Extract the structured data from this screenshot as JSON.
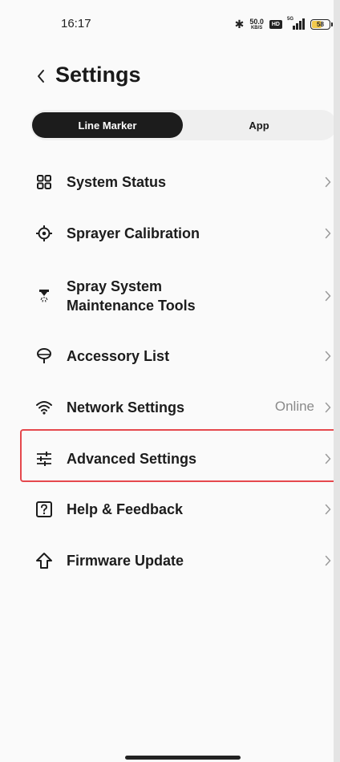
{
  "status_bar": {
    "time": "16:17",
    "net_speed_value": "50.0",
    "net_speed_unit": "KB/S",
    "hd_badge": "HD",
    "network_type": "5G",
    "battery_level": "58",
    "icons": [
      "bluetooth-icon",
      "hd-icon",
      "signal-icon",
      "battery-icon"
    ]
  },
  "header": {
    "title": "Settings",
    "back_icon": "chevron-left-icon"
  },
  "segment": {
    "tabs": [
      {
        "label": "Line Marker",
        "selected": true
      },
      {
        "label": "App",
        "selected": false
      }
    ]
  },
  "menu": {
    "items": [
      {
        "id": "system-status",
        "label": "System Status",
        "icon": "grid-icon"
      },
      {
        "id": "sprayer-calibration",
        "label": "Sprayer Calibration",
        "icon": "crosshair-icon"
      },
      {
        "id": "spray-system-maintenance",
        "label_line1": "Spray System",
        "label_line2": "Maintenance Tools",
        "icon": "spray-nozzle-icon"
      },
      {
        "id": "accessory-list",
        "label": "Accessory List",
        "icon": "accessory-icon"
      },
      {
        "id": "network-settings",
        "label": "Network Settings",
        "icon": "wifi-icon",
        "status": "Online"
      },
      {
        "id": "advanced-settings",
        "label": "Advanced Settings",
        "icon": "sliders-icon",
        "highlighted": true
      },
      {
        "id": "help-feedback",
        "label": "Help & Feedback",
        "icon": "help-icon"
      },
      {
        "id": "firmware-update",
        "label": "Firmware Update",
        "icon": "upload-arrow-icon"
      }
    ]
  },
  "colors": {
    "accent_dark": "#1c1c1c",
    "highlight_border": "#e5484d",
    "muted_text": "#8a8a8a",
    "battery_fill": "#f2c94c"
  }
}
